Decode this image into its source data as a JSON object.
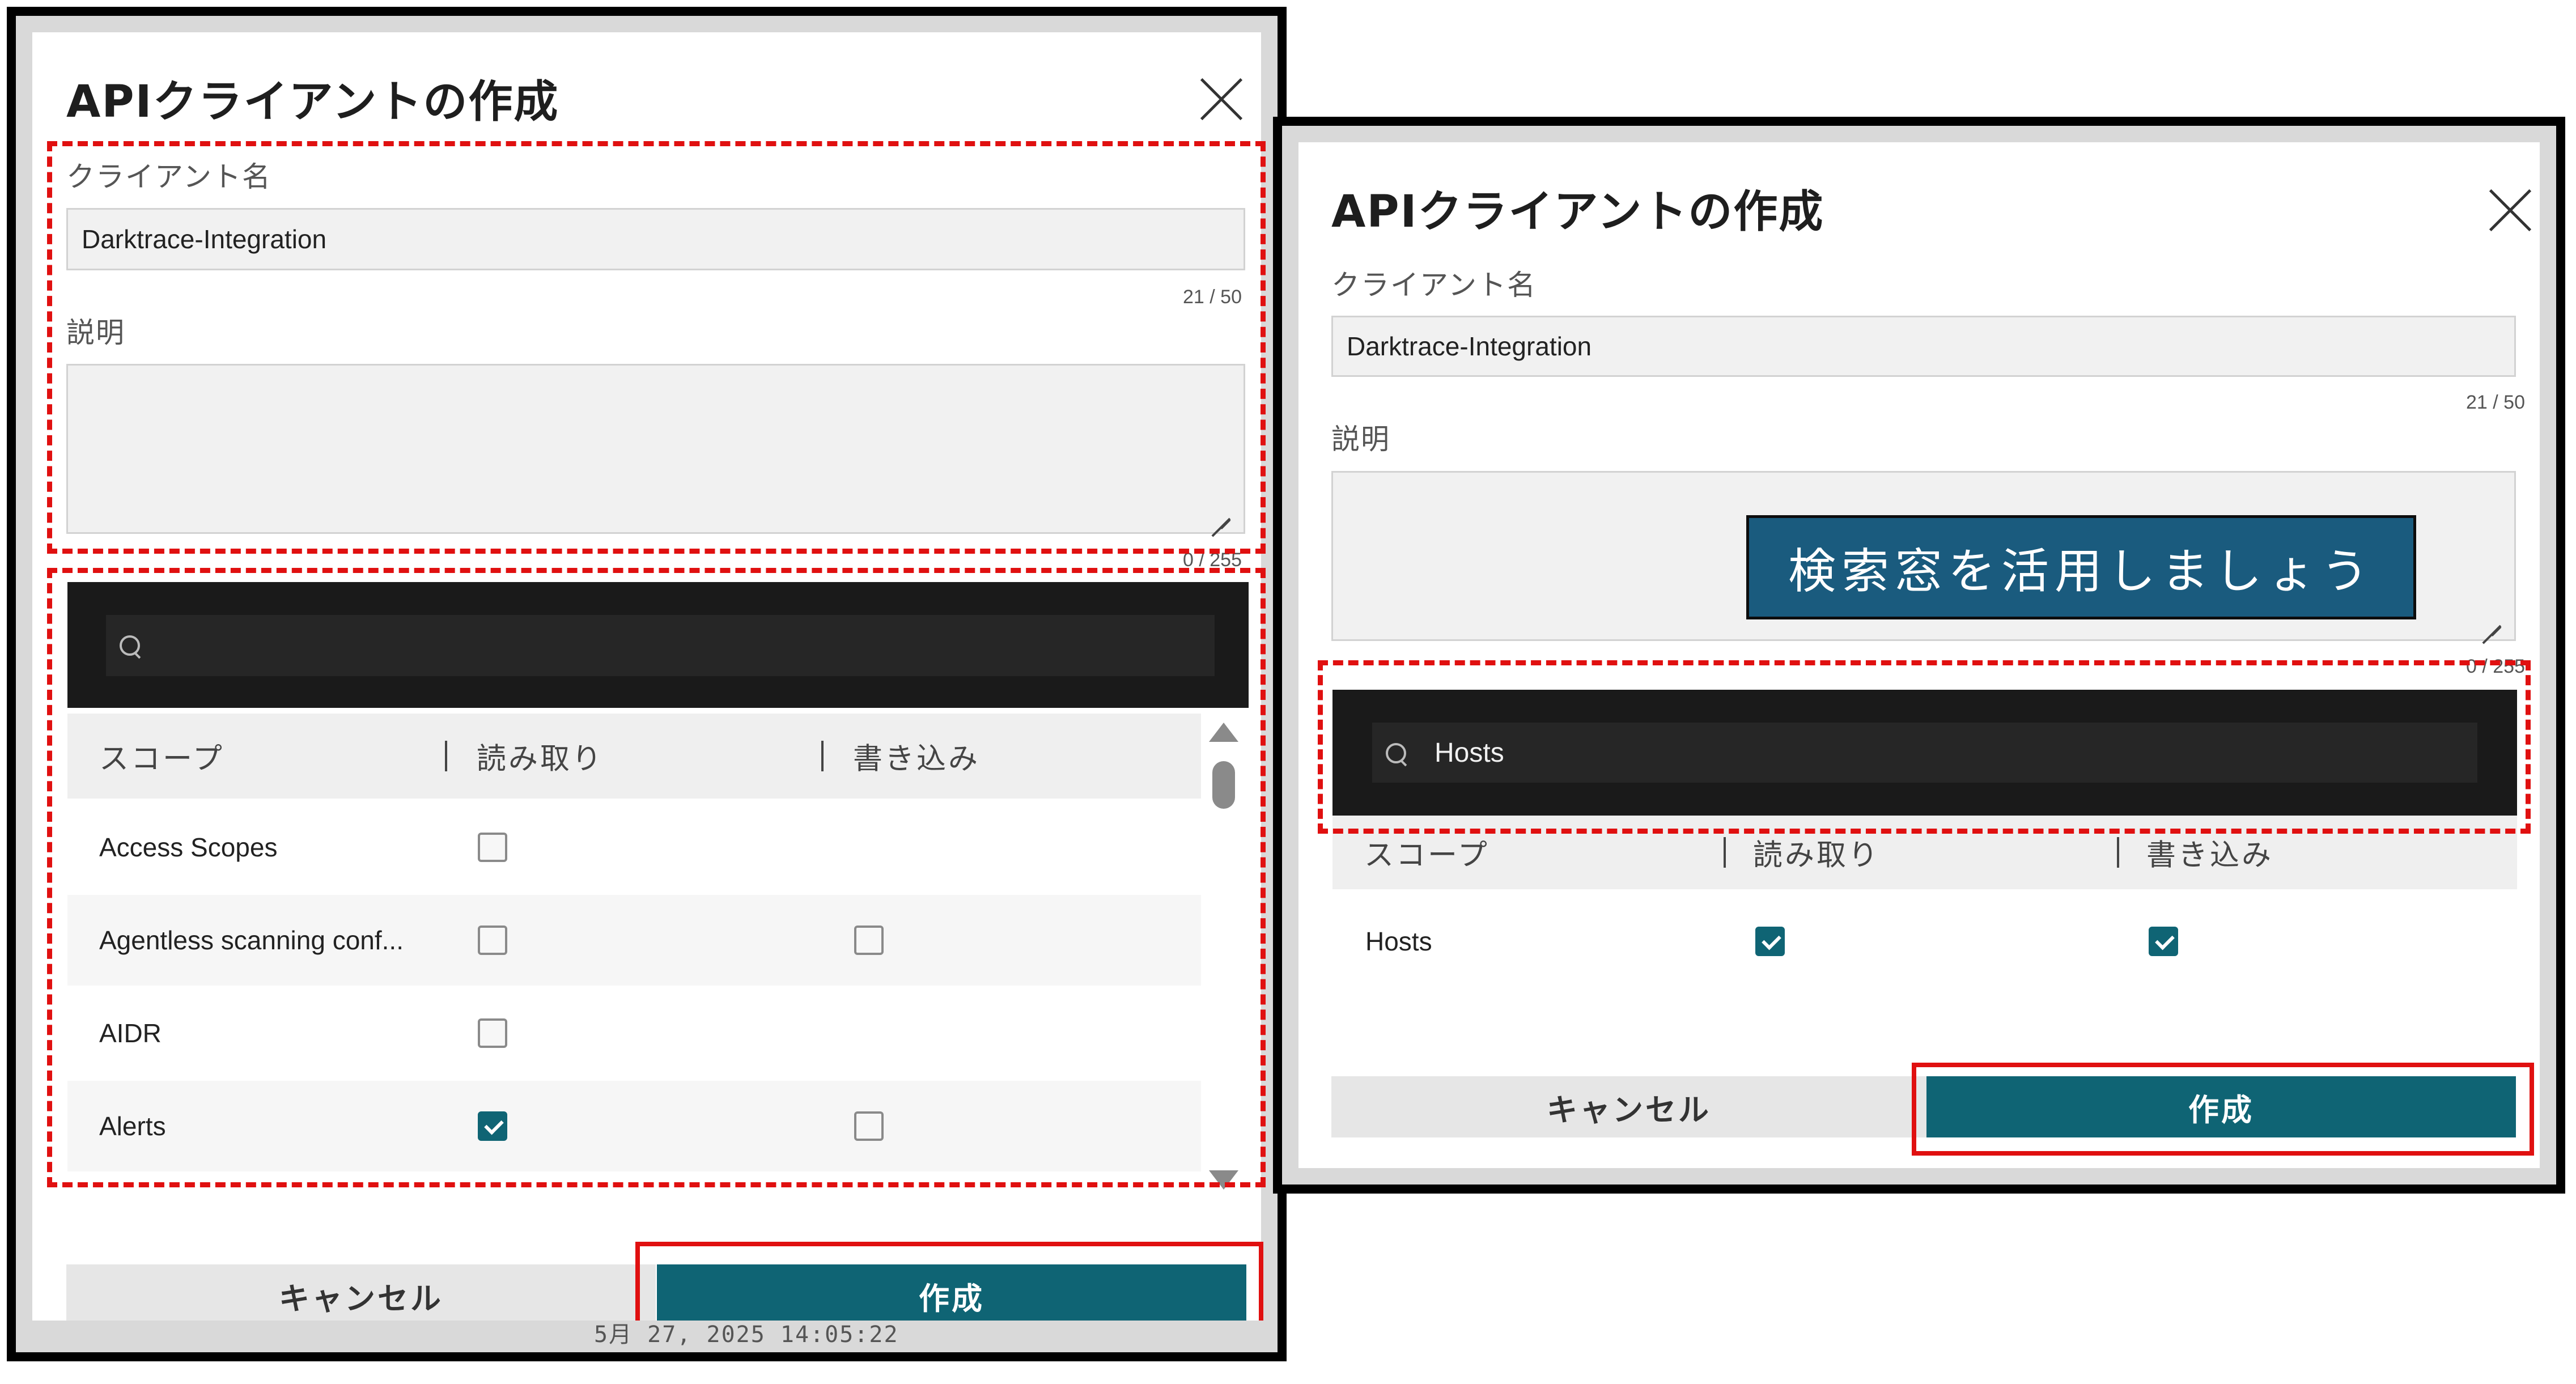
{
  "dialog": {
    "title": "APIクライアントの作成",
    "client_name_label": "クライアント名",
    "client_name_value": "Darktrace-Integration",
    "client_name_counter": "21 / 50",
    "description_label": "説明",
    "description_value": "",
    "description_counter": "0 / 255",
    "cancel_label": "キャンセル",
    "create_label": "作成"
  },
  "scopes_table": {
    "columns": [
      "スコープ",
      "読み取り",
      "書き込み"
    ],
    "rows_left": [
      {
        "scope": "Access Scopes",
        "read": false,
        "write": null
      },
      {
        "scope": "Agentless scanning conf...",
        "read": false,
        "write": false
      },
      {
        "scope": "AIDR",
        "read": false,
        "write": null
      },
      {
        "scope": "Alerts",
        "read": true,
        "write": false
      }
    ],
    "rows_right": [
      {
        "scope": "Hosts",
        "read": true,
        "write": true
      }
    ]
  },
  "search": {
    "left_value": "",
    "right_value": "Hosts"
  },
  "callout_text": "検索窓を活用しましょう",
  "background_fragment": "5月 27, 2025 14:05:22",
  "stray_mark": "1",
  "colors": {
    "accent": "#0f6474",
    "highlight": "#e01010",
    "callout": "#1a5b7e",
    "search_bar": "#1a1a1a"
  }
}
